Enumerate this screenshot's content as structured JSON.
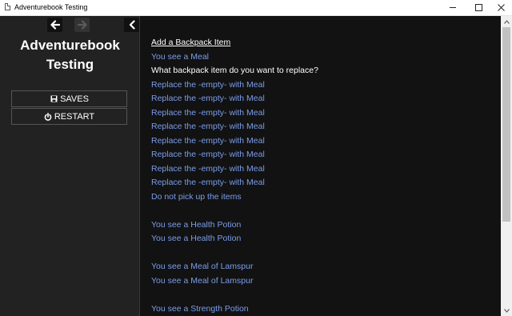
{
  "window": {
    "title": "Adventurebook Testing",
    "controls": [
      "minimize",
      "maximize",
      "close"
    ]
  },
  "sidebar": {
    "title_line1": "Adventurebook",
    "title_line2": "Testing",
    "nav": {
      "back_icon": "arrow-left-icon",
      "forward_icon": "arrow-right-icon",
      "forward_enabled": false,
      "collapse_icon": "chevron-left-icon"
    },
    "buttons": {
      "saves_label": "SAVES",
      "saves_icon": "floppy-disk-icon",
      "restart_label": "RESTART",
      "restart_icon": "power-icon"
    }
  },
  "main": {
    "heading": "Add a Backpack Item",
    "intro_link": "You see a Meal",
    "question": "What backpack item do you want to replace?",
    "replace_options": [
      "Replace the -empty- with Meal",
      "Replace the -empty- with Meal",
      "Replace the -empty- with Meal",
      "Replace the -empty- with Meal",
      "Replace the -empty- with Meal",
      "Replace the -empty- with Meal",
      "Replace the -empty- with Meal",
      "Replace the -empty- with Meal"
    ],
    "decline_link": "Do not pick up the items",
    "group_health": [
      "You see a Health Potion",
      "You see a Health Potion"
    ],
    "group_lamspur": [
      "You see a Meal of Lamspur",
      "You see a Meal of Lamspur"
    ],
    "group_strength": [
      "You see a Strength Potion"
    ]
  },
  "colors": {
    "sidebar_bg": "#222222",
    "main_bg": "#121212",
    "link": "#7b9dea",
    "text": "#ffffff"
  }
}
